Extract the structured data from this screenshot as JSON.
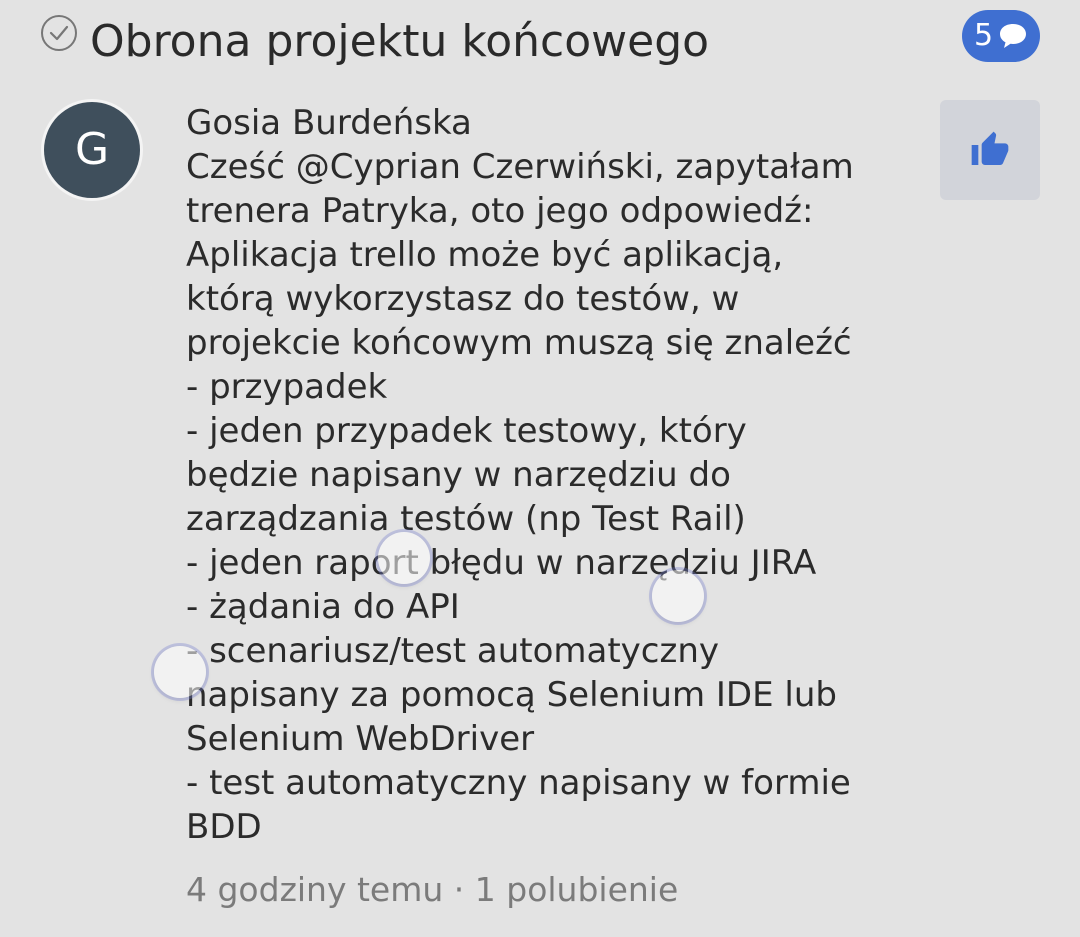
{
  "post": {
    "title": "Obrona projektu końcowego",
    "comment_count": "5",
    "status_icon": "check-circle-icon",
    "comment_icon": "speech-bubble-icon"
  },
  "comment": {
    "avatar_letter": "G",
    "author": "Gosia Burdeńska",
    "lines": [
      "Cześć @Cyprian Czerwiński, zapytałam",
      "trenera Patryka, oto jego odpowiedź:",
      "Aplikacja trello może być aplikacją,",
      "którą wykorzystasz do testów, w",
      "projekcie końcowym muszą się znaleźć",
      "- przypadek",
      "- jeden przypadek testowy, który",
      "będzie napisany w narzędziu do",
      "zarządzania testów (np Test Rail)",
      "- jeden raport błędu w narzędziu JIRA",
      "- żądania do API",
      "- scenariusz/test automatyczny",
      "napisany za pomocą Selenium IDE lub",
      "Selenium WebDriver",
      "- test automatyczny napisany w formie",
      "BDD"
    ],
    "meta": "4 godziny temu · 1 polubienie",
    "like_icon": "thumbs-up-icon"
  },
  "colors": {
    "background": "#e3e3e3",
    "badge": "#3f6fd1",
    "avatar": "#3f4f5c",
    "like_button": "#d2d4da",
    "like_icon": "#3f6fd1"
  }
}
